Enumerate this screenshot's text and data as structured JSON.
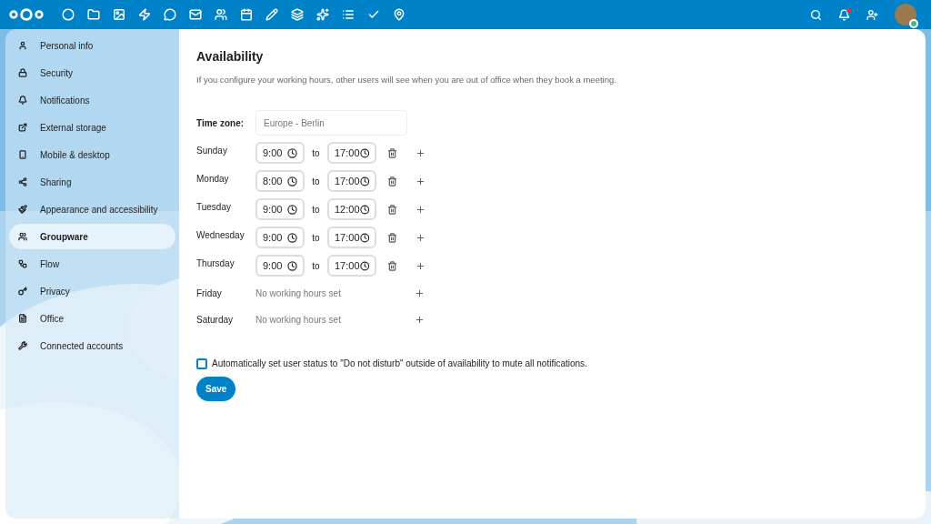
{
  "sidebar": {
    "items": [
      {
        "label": "Personal info",
        "selected": false
      },
      {
        "label": "Security",
        "selected": false
      },
      {
        "label": "Notifications",
        "selected": false
      },
      {
        "label": "External storage",
        "selected": false
      },
      {
        "label": "Mobile & desktop",
        "selected": false
      },
      {
        "label": "Sharing",
        "selected": false
      },
      {
        "label": "Appearance and accessibility",
        "selected": false
      },
      {
        "label": "Groupware",
        "selected": true
      },
      {
        "label": "Flow",
        "selected": false
      },
      {
        "label": "Privacy",
        "selected": false
      },
      {
        "label": "Office",
        "selected": false
      },
      {
        "label": "Connected accounts",
        "selected": false
      }
    ]
  },
  "availability": {
    "title": "Availability",
    "description": "If you configure your working hours, other users will see when you are out of office when they book a meeting.",
    "timezone": {
      "label": "Time zone:",
      "value": "Europe - Berlin"
    },
    "days": [
      {
        "day": "Sunday",
        "kind": "slots",
        "from": "9:00",
        "separator": "to",
        "to": "17:00"
      },
      {
        "day": "Monday",
        "kind": "slots",
        "from": "8:00",
        "separator": "to",
        "to": "17:00"
      },
      {
        "day": "Tuesday",
        "kind": "slots",
        "from": "9:00",
        "separator": "to",
        "to": "12:00"
      },
      {
        "day": "Wednesday",
        "kind": "slots",
        "from": "9:00",
        "separator": "to",
        "to": "17:00"
      },
      {
        "day": "Thursday",
        "kind": "slots",
        "from": "9:00",
        "separator": "to",
        "to": "17:00"
      },
      {
        "day": "Friday",
        "kind": "none",
        "empty_text": "No working hours set"
      },
      {
        "day": "Saturday",
        "kind": "none",
        "empty_text": "No working hours set"
      }
    ],
    "dnd": {
      "label": "Automatically set user status to \"Do not disturb\" outside of availability to mute all notifications.",
      "checked": false
    },
    "save": "Save"
  }
}
